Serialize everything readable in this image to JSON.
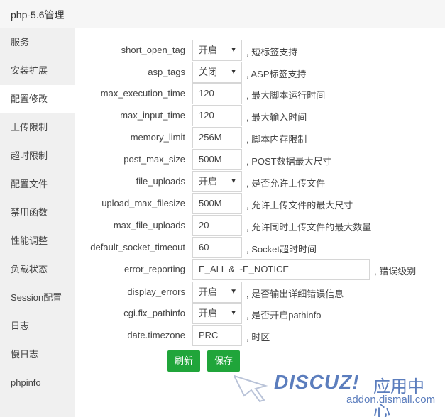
{
  "window": {
    "title": "php-5.6管理"
  },
  "sidebar": {
    "items": [
      {
        "label": "服务"
      },
      {
        "label": "安装扩展"
      },
      {
        "label": "配置修改"
      },
      {
        "label": "上传限制"
      },
      {
        "label": "超时限制"
      },
      {
        "label": "配置文件"
      },
      {
        "label": "禁用函数"
      },
      {
        "label": "性能调整"
      },
      {
        "label": "负载状态"
      },
      {
        "label": "Session配置"
      },
      {
        "label": "日志"
      },
      {
        "label": "慢日志"
      },
      {
        "label": "phpinfo"
      }
    ],
    "active_index": 2
  },
  "form": {
    "rows": [
      {
        "key": "short_open_tag",
        "value": "开启",
        "type": "select",
        "hint": ", 短标签支持"
      },
      {
        "key": "asp_tags",
        "value": "关闭",
        "type": "select",
        "hint": ", ASP标签支持"
      },
      {
        "key": "max_execution_time",
        "value": "120",
        "type": "input",
        "hint": ", 最大脚本运行时间"
      },
      {
        "key": "max_input_time",
        "value": "120",
        "type": "input",
        "hint": ", 最大输入时间"
      },
      {
        "key": "memory_limit",
        "value": "256M",
        "type": "input",
        "hint": ", 脚本内存限制"
      },
      {
        "key": "post_max_size",
        "value": "500M",
        "type": "input",
        "hint": ", POST数据最大尺寸"
      },
      {
        "key": "file_uploads",
        "value": "开启",
        "type": "select",
        "hint": ", 是否允许上传文件"
      },
      {
        "key": "upload_max_filesize",
        "value": "500M",
        "type": "input",
        "hint": ", 允许上传文件的最大尺寸"
      },
      {
        "key": "max_file_uploads",
        "value": "20",
        "type": "input",
        "hint": ", 允许同时上传文件的最大数量"
      },
      {
        "key": "default_socket_timeout",
        "value": "60",
        "type": "input",
        "hint": ", Socket超时时间"
      },
      {
        "key": "error_reporting",
        "value": "E_ALL & ~E_NOTICE",
        "type": "input-wide",
        "hint": ", 错误级别"
      },
      {
        "key": "display_errors",
        "value": "开启",
        "type": "select",
        "hint": ", 是否输出详细错误信息"
      },
      {
        "key": "cgi.fix_pathinfo",
        "value": "开启",
        "type": "select",
        "hint": ", 是否开启pathinfo"
      },
      {
        "key": "date.timezone",
        "value": "PRC",
        "type": "input",
        "hint": ", 时区"
      }
    ],
    "caret": "▼"
  },
  "buttons": {
    "refresh": "刷新",
    "save": "保存"
  },
  "colors": {
    "accent": "#20a53a",
    "sidebar_bg": "#f0f0f0",
    "watermark": "#5b7dbd"
  },
  "watermark": {
    "logo": "DISCUZ!",
    "cn": "应用中心",
    "url": "addon.dismall.com"
  }
}
